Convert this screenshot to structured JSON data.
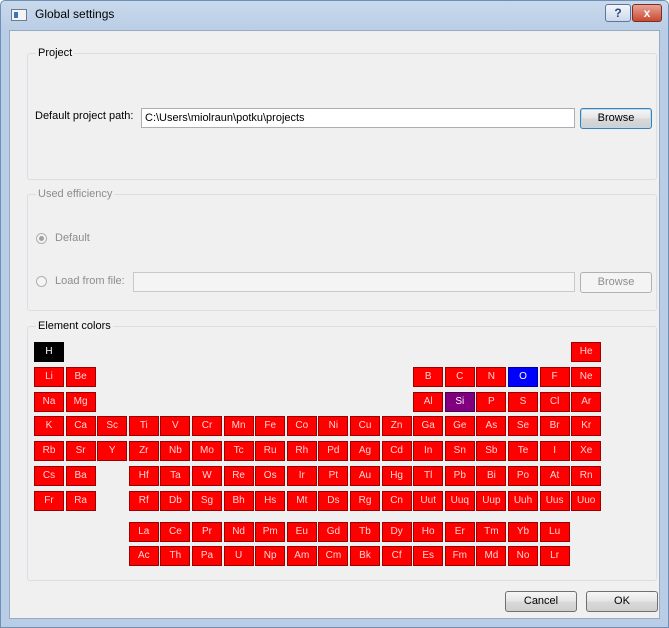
{
  "window": {
    "title": "Global settings",
    "help_label": "?",
    "close_label": "x"
  },
  "project": {
    "group_title": "Project",
    "path_label": "Default project path:",
    "path_value": "C:\\Users\\miolraun\\potku\\projects",
    "browse_label": "Browse"
  },
  "efficiency": {
    "group_title": "Used efficiency",
    "default_label": "Default",
    "load_label": "Load from file:",
    "file_value": "",
    "browse_label": "Browse"
  },
  "elements": {
    "group_title": "Element colors",
    "colors": {
      "default": "#ff0000",
      "H": "#000000",
      "O": "#0000ff",
      "Si": "#800080"
    },
    "rows": [
      [
        "H",
        "He"
      ],
      [
        "Li",
        "Be",
        "B",
        "C",
        "N",
        "O",
        "F",
        "Ne"
      ],
      [
        "Na",
        "Mg",
        "Al",
        "Si",
        "P",
        "S",
        "Cl",
        "Ar"
      ],
      [
        "K",
        "Ca",
        "Sc",
        "Ti",
        "V",
        "Cr",
        "Mn",
        "Fe",
        "Co",
        "Ni",
        "Cu",
        "Zn",
        "Ga",
        "Ge",
        "As",
        "Se",
        "Br",
        "Kr"
      ],
      [
        "Rb",
        "Sr",
        "Y",
        "Zr",
        "Nb",
        "Mo",
        "Tc",
        "Ru",
        "Rh",
        "Pd",
        "Ag",
        "Cd",
        "In",
        "Sn",
        "Sb",
        "Te",
        "I",
        "Xe"
      ],
      [
        "Cs",
        "Ba",
        "Hf",
        "Ta",
        "W",
        "Re",
        "Os",
        "Ir",
        "Pt",
        "Au",
        "Hg",
        "Tl",
        "Pb",
        "Bi",
        "Po",
        "At",
        "Rn"
      ],
      [
        "Fr",
        "Ra",
        "Rf",
        "Db",
        "Sg",
        "Bh",
        "Hs",
        "Mt",
        "Ds",
        "Rg",
        "Cn",
        "Uut",
        "Uuq",
        "Uup",
        "Uuh",
        "Uus",
        "Uuo"
      ],
      [
        "La",
        "Ce",
        "Pr",
        "Nd",
        "Pm",
        "Eu",
        "Gd",
        "Tb",
        "Dy",
        "Ho",
        "Er",
        "Tm",
        "Yb",
        "Lu"
      ],
      [
        "Ac",
        "Th",
        "Pa",
        "U",
        "Np",
        "Am",
        "Cm",
        "Bk",
        "Cf",
        "Es",
        "Fm",
        "Md",
        "No",
        "Lr"
      ]
    ]
  },
  "footer": {
    "cancel_label": "Cancel",
    "ok_label": "OK"
  }
}
